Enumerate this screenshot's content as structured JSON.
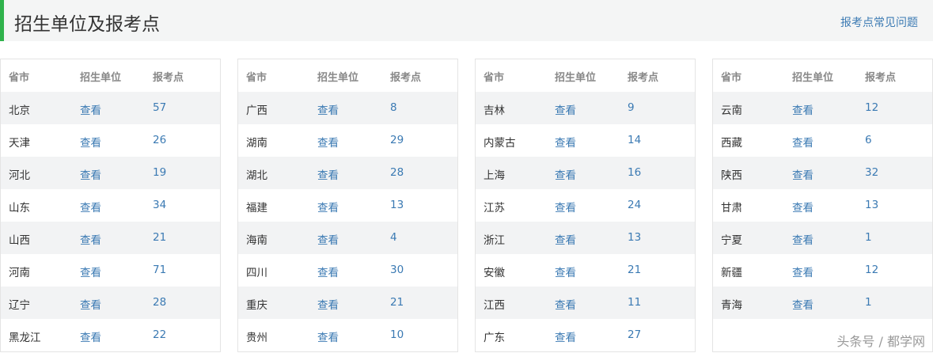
{
  "header": {
    "title": "招生单位及报考点",
    "faq_link": "报考点常见问题"
  },
  "columns": [
    "省市",
    "招生单位",
    "报考点"
  ],
  "view_label": "查看",
  "tables": [
    [
      [
        "北京",
        "57"
      ],
      [
        "天津",
        "26"
      ],
      [
        "河北",
        "19"
      ],
      [
        "山东",
        "34"
      ],
      [
        "山西",
        "21"
      ],
      [
        "河南",
        "71"
      ],
      [
        "辽宁",
        "28"
      ],
      [
        "黑龙江",
        "22"
      ]
    ],
    [
      [
        "广西",
        "8"
      ],
      [
        "湖南",
        "29"
      ],
      [
        "湖北",
        "28"
      ],
      [
        "福建",
        "13"
      ],
      [
        "海南",
        "4"
      ],
      [
        "四川",
        "30"
      ],
      [
        "重庆",
        "21"
      ],
      [
        "贵州",
        "10"
      ]
    ],
    [
      [
        "吉林",
        "9"
      ],
      [
        "内蒙古",
        "14"
      ],
      [
        "上海",
        "16"
      ],
      [
        "江苏",
        "24"
      ],
      [
        "浙江",
        "13"
      ],
      [
        "安徽",
        "21"
      ],
      [
        "江西",
        "11"
      ],
      [
        "广东",
        "27"
      ]
    ],
    [
      [
        "云南",
        "12"
      ],
      [
        "西藏",
        "6"
      ],
      [
        "陕西",
        "32"
      ],
      [
        "甘肃",
        "13"
      ],
      [
        "宁夏",
        "1"
      ],
      [
        "新疆",
        "12"
      ],
      [
        "青海",
        "1"
      ]
    ]
  ],
  "watermark": "头条号 / 都学网"
}
